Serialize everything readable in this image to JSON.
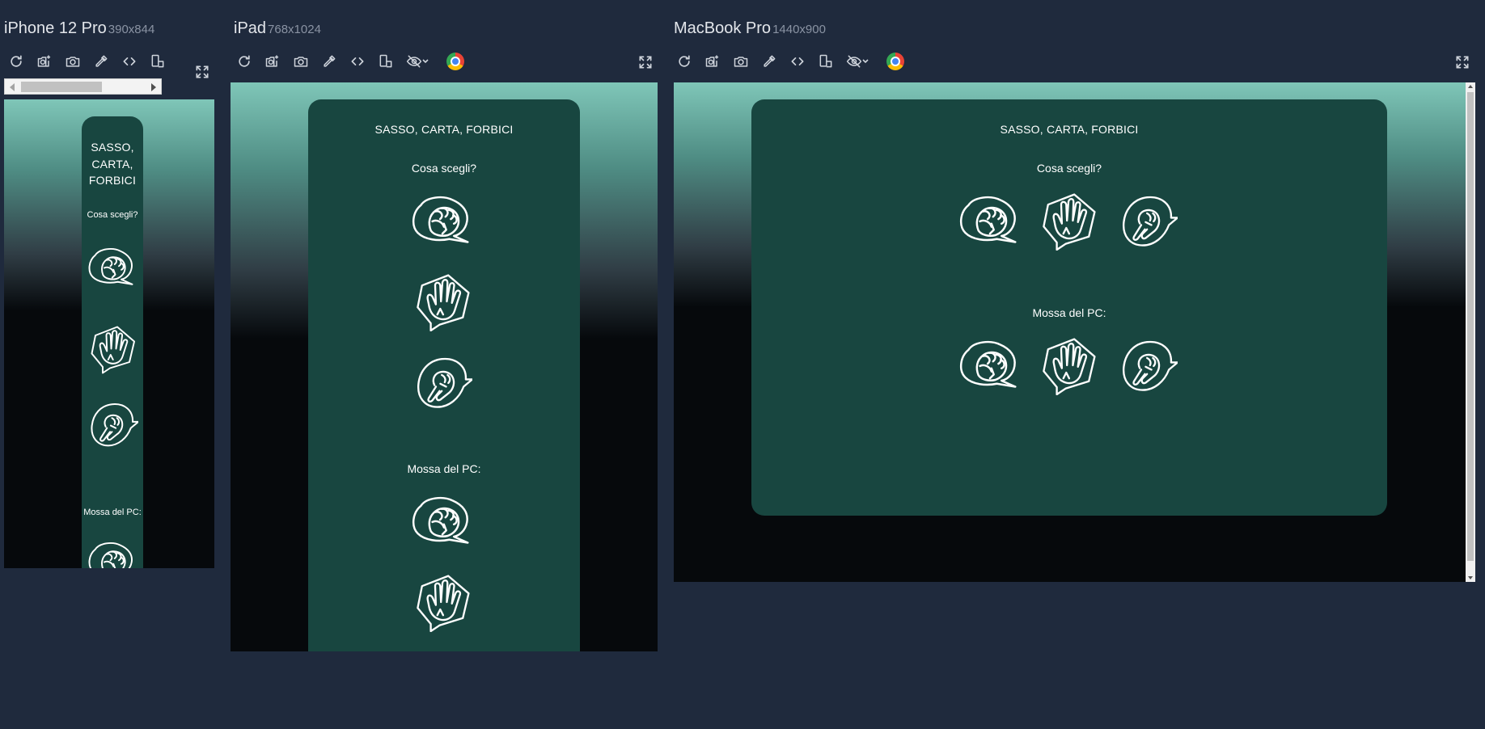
{
  "devices": [
    {
      "name": "iPhone 12 Pro",
      "size": "390x844"
    },
    {
      "name": "iPad",
      "size": "768x1024"
    },
    {
      "name": "MacBook Pro",
      "size": "1440x900"
    }
  ],
  "toolbar_icons": [
    "refresh-icon",
    "camera-plus-icon",
    "camera-icon",
    "eyedropper-icon",
    "code-icon",
    "rotate-device-icon",
    "eye-off-icon",
    "chevron-down-icon",
    "browser-logo-icon",
    "fullscreen-icon"
  ],
  "app": {
    "title": "SASSO, CARTA, FORBICI",
    "title_lines": [
      "SASSO,",
      "CARTA,",
      "FORBICI"
    ],
    "choose_label": "Cosa scegli?",
    "pc_label": "Mossa del PC:",
    "moves": [
      "sasso",
      "carta",
      "forbici"
    ]
  },
  "colors": {
    "background": "#1f2a3d",
    "card": "#184640",
    "gradient_top": "#7fc6b8",
    "viewport_bottom": "#06090c"
  }
}
